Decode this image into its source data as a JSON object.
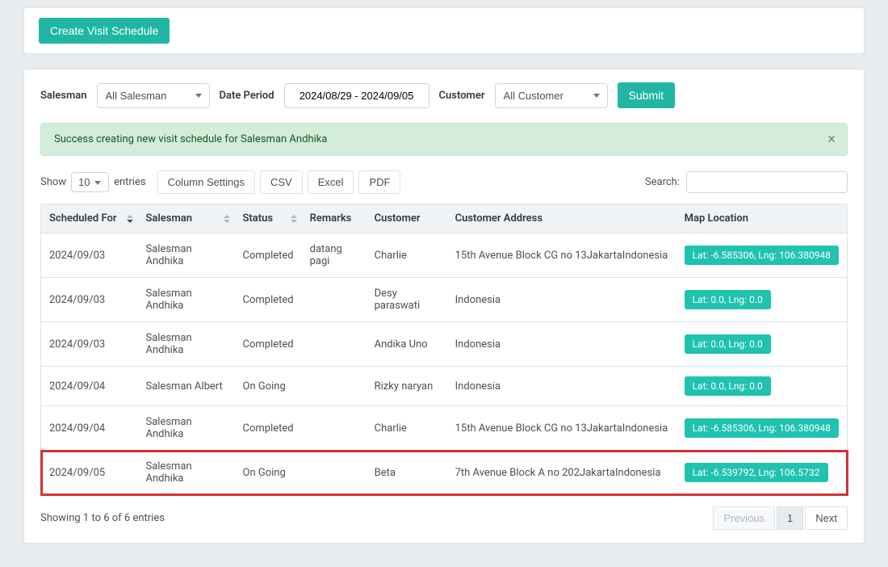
{
  "header": {
    "create_button": "Create Visit Schedule"
  },
  "filters": {
    "salesman_label": "Salesman",
    "salesman_value": "All Salesman",
    "date_label": "Date Period",
    "date_range": "2024/08/29 - 2024/09/05",
    "customer_label": "Customer",
    "customer_value": "All Customer",
    "submit_label": "Submit"
  },
  "alert": {
    "message": "Success creating new visit schedule for Salesman Andhika"
  },
  "table_controls": {
    "show_label": "Show",
    "page_length": "10",
    "entries_label": "entries",
    "column_settings": "Column Settings",
    "csv": "CSV",
    "excel": "Excel",
    "pdf": "PDF",
    "search_label": "Search:"
  },
  "columns": {
    "scheduled_for": "Scheduled For",
    "salesman": "Salesman",
    "status": "Status",
    "remarks": "Remarks",
    "customer": "Customer",
    "customer_address": "Customer Address",
    "map_location": "Map Location"
  },
  "rows": [
    {
      "scheduled_for": "2024/09/03",
      "salesman": "Salesman Andhika",
      "status": "Completed",
      "remarks": "datang pagi",
      "customer": "Charlie",
      "address": "15th Avenue Block CG no 13JakartaIndonesia",
      "map": "Lat: -6.585306, Lng: 106.380948",
      "highlight": false
    },
    {
      "scheduled_for": "2024/09/03",
      "salesman": "Salesman Andhika",
      "status": "Completed",
      "remarks": "",
      "customer": "Desy paraswati",
      "address": "Indonesia",
      "map": "Lat: 0.0, Lng: 0.0",
      "highlight": false
    },
    {
      "scheduled_for": "2024/09/03",
      "salesman": "Salesman Andhika",
      "status": "Completed",
      "remarks": "",
      "customer": "Andika Uno",
      "address": "Indonesia",
      "map": "Lat: 0.0, Lng: 0.0",
      "highlight": false
    },
    {
      "scheduled_for": "2024/09/04",
      "salesman": "Salesman Albert",
      "status": "On Going",
      "remarks": "",
      "customer": "Rizky naryan",
      "address": "Indonesia",
      "map": "Lat: 0.0, Lng: 0.0",
      "highlight": false
    },
    {
      "scheduled_for": "2024/09/04",
      "salesman": "Salesman Andhika",
      "status": "Completed",
      "remarks": "",
      "customer": "Charlie",
      "address": "15th Avenue Block CG no 13JakartaIndonesia",
      "map": "Lat: -6.585306, Lng: 106.380948",
      "highlight": false
    },
    {
      "scheduled_for": "2024/09/05",
      "salesman": "Salesman Andhika",
      "status": "On Going",
      "remarks": "",
      "customer": "Beta",
      "address": "7th Avenue Block A no 202JakartaIndonesia",
      "map": "Lat: -6.539792, Lng: 106.5732",
      "highlight": true
    }
  ],
  "footer": {
    "info": "Showing 1 to 6 of 6 entries",
    "prev": "Previous",
    "page": "1",
    "next": "Next"
  }
}
